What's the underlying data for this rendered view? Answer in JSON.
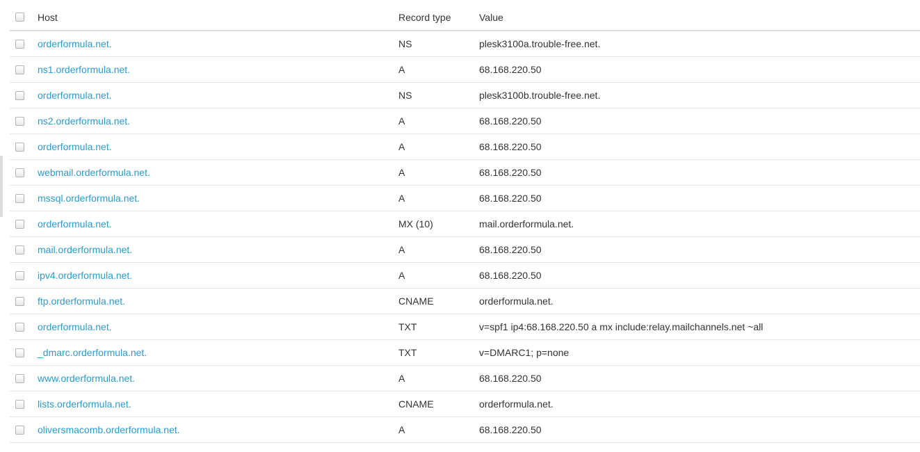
{
  "columns": {
    "host": "Host",
    "record_type": "Record type",
    "value": "Value"
  },
  "colors": {
    "link": "#2a9bcb",
    "text": "#333333",
    "row_border": "#e6e6e6"
  },
  "records": [
    {
      "host": "orderformula.net.",
      "type": "NS",
      "value": "plesk3100a.trouble-free.net."
    },
    {
      "host": "ns1.orderformula.net.",
      "type": "A",
      "value": "68.168.220.50"
    },
    {
      "host": "orderformula.net.",
      "type": "NS",
      "value": "plesk3100b.trouble-free.net."
    },
    {
      "host": "ns2.orderformula.net.",
      "type": "A",
      "value": "68.168.220.50"
    },
    {
      "host": "orderformula.net.",
      "type": "A",
      "value": "68.168.220.50"
    },
    {
      "host": "webmail.orderformula.net.",
      "type": "A",
      "value": "68.168.220.50"
    },
    {
      "host": "mssql.orderformula.net.",
      "type": "A",
      "value": "68.168.220.50"
    },
    {
      "host": "orderformula.net.",
      "type": "MX (10)",
      "value": "mail.orderformula.net."
    },
    {
      "host": "mail.orderformula.net.",
      "type": "A",
      "value": "68.168.220.50"
    },
    {
      "host": "ipv4.orderformula.net.",
      "type": "A",
      "value": "68.168.220.50"
    },
    {
      "host": "ftp.orderformula.net.",
      "type": "CNAME",
      "value": "orderformula.net."
    },
    {
      "host": "orderformula.net.",
      "type": "TXT",
      "value": "v=spf1 ip4:68.168.220.50 a mx include:relay.mailchannels.net ~all"
    },
    {
      "host": "_dmarc.orderformula.net.",
      "type": "TXT",
      "value": "v=DMARC1; p=none"
    },
    {
      "host": "www.orderformula.net.",
      "type": "A",
      "value": "68.168.220.50"
    },
    {
      "host": "lists.orderformula.net.",
      "type": "CNAME",
      "value": "orderformula.net."
    },
    {
      "host": "oliversmacomb.orderformula.net.",
      "type": "A",
      "value": "68.168.220.50"
    }
  ]
}
